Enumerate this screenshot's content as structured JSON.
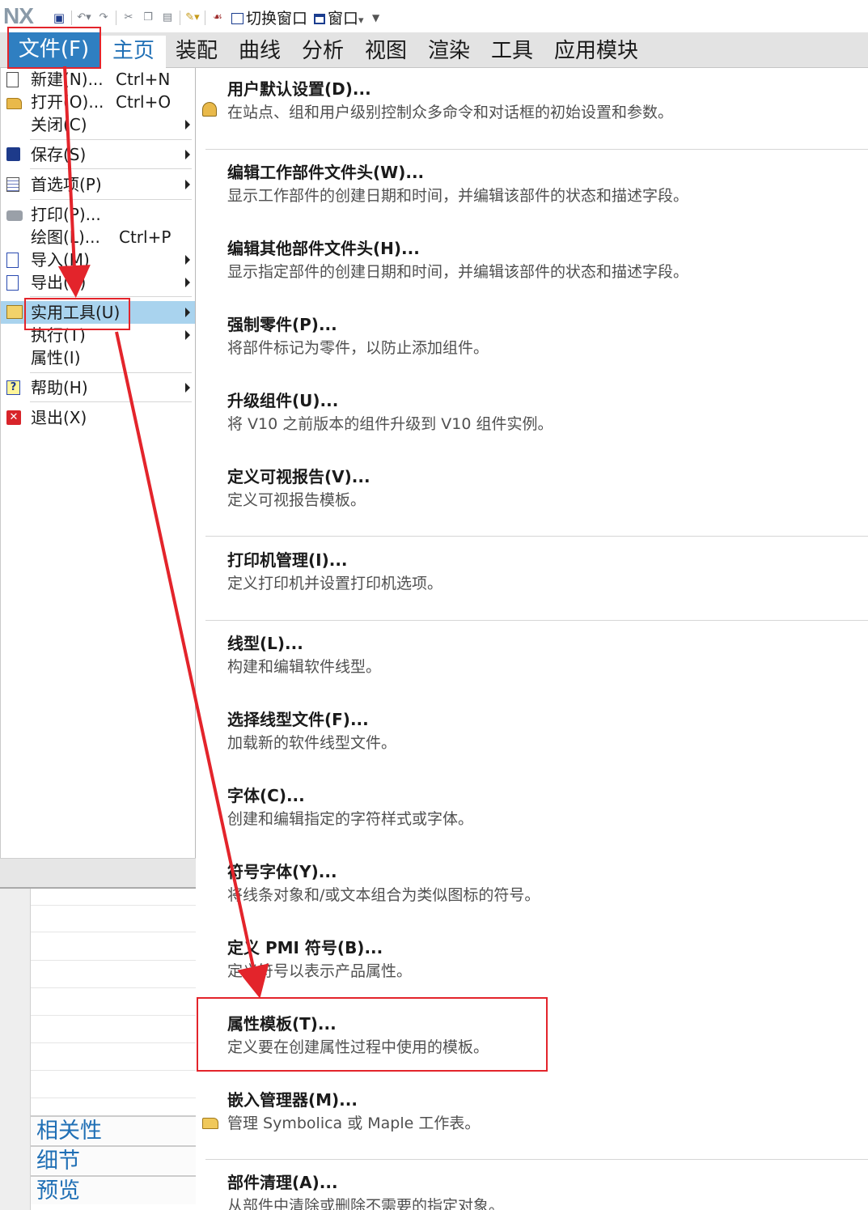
{
  "app": {
    "logo": "NX"
  },
  "quick_access": {
    "switch_window": "切换窗口",
    "window": "窗口",
    "icons": [
      "save-icon",
      "undo-icon",
      "redo-icon",
      "cut-icon",
      "copy-icon",
      "paste-icon",
      "touch-mode-icon",
      "brush-icon"
    ]
  },
  "ribbon": {
    "tabs": [
      "文件(F)",
      "主页",
      "装配",
      "曲线",
      "分析",
      "视图",
      "渲染",
      "工具",
      "应用模块"
    ]
  },
  "file_menu": {
    "items": [
      {
        "label": "新建(N)...",
        "shortcut": "Ctrl+N",
        "icon": "new-file-icon"
      },
      {
        "label": "打开(O)...",
        "shortcut": "Ctrl+O",
        "icon": "open-folder-icon"
      },
      {
        "label": "关闭(C)",
        "shortcut": "",
        "icon": ""
      },
      {
        "label": "保存(S)",
        "shortcut": "",
        "icon": "save-icon"
      },
      {
        "label": "首选项(P)",
        "shortcut": "",
        "icon": "preferences-icon"
      },
      {
        "label": "打印(P)...",
        "shortcut": "",
        "icon": "printer-icon"
      },
      {
        "label": "绘图(L)...",
        "shortcut": "Ctrl+P",
        "icon": ""
      },
      {
        "label": "导入(M)",
        "shortcut": "",
        "icon": "import-icon"
      },
      {
        "label": "导出(E)",
        "shortcut": "",
        "icon": "export-icon"
      },
      {
        "label": "实用工具(U)",
        "shortcut": "",
        "icon": "utilities-icon"
      },
      {
        "label": "执行(T)",
        "shortcut": "",
        "icon": ""
      },
      {
        "label": "属性(I)",
        "shortcut": "",
        "icon": ""
      },
      {
        "label": "帮助(H)",
        "shortcut": "",
        "icon": "help-icon"
      },
      {
        "label": "退出(X)",
        "shortcut": "",
        "icon": "exit-icon"
      }
    ]
  },
  "side_panel": {
    "sections": [
      "相关性",
      "细节",
      "预览"
    ]
  },
  "utilities_submenu": {
    "items": [
      {
        "title": "用户默认设置(D)...",
        "desc": "在站点、组和用户级别控制众多命令和对话框的初始设置和参数。"
      },
      {
        "title": "编辑工作部件文件头(W)...",
        "desc": "显示工作部件的创建日期和时间，并编辑该部件的状态和描述字段。"
      },
      {
        "title": "编辑其他部件文件头(H)...",
        "desc": "显示指定部件的创建日期和时间，并编辑该部件的状态和描述字段。"
      },
      {
        "title": "强制零件(P)...",
        "desc": "将部件标记为零件，以防止添加组件。"
      },
      {
        "title": "升级组件(U)...",
        "desc": "将 V10 之前版本的组件升级到 V10 组件实例。"
      },
      {
        "title": "定义可视报告(V)...",
        "desc": "定义可视报告模板。"
      },
      {
        "title": "打印机管理(I)...",
        "desc": "定义打印机并设置打印机选项。"
      },
      {
        "title": "线型(L)...",
        "desc": "构建和编辑软件线型。"
      },
      {
        "title": "选择线型文件(F)...",
        "desc": "加载新的软件线型文件。"
      },
      {
        "title": "字体(C)...",
        "desc": "创建和编辑指定的字符样式或字体。"
      },
      {
        "title": "符号字体(Y)...",
        "desc": "将线条对象和/或文本组合为类似图标的符号。"
      },
      {
        "title": "定义 PMI 符号(B)...",
        "desc": "定义符号以表示产品属性。"
      },
      {
        "title": "属性模板(T)...",
        "desc": "定义要在创建属性过程中使用的模板。"
      },
      {
        "title": "嵌入管理器(M)...",
        "desc": "管理 Symbolica 或 Maple 工作表。"
      },
      {
        "title": "部件清理(A)...",
        "desc": "从部件中清除或删除不需要的指定对象。"
      }
    ]
  },
  "annotation": {
    "color": "#e3242b"
  },
  "colors": {
    "file_tab": "#2f7fc1",
    "home_tab_text": "#1f6fb5",
    "highlight": "#a9d3ee"
  }
}
